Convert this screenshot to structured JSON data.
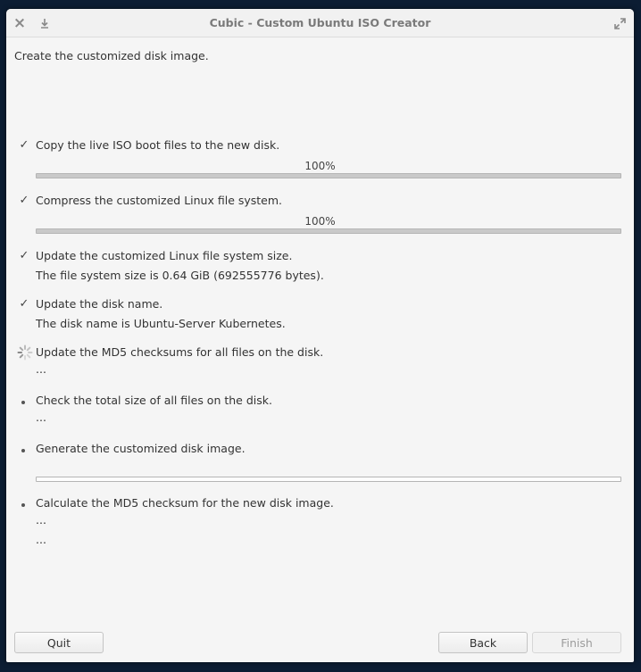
{
  "window": {
    "title": "Cubic - Custom Ubuntu ISO Creator"
  },
  "intro": "Create the customized disk image.",
  "steps": [
    {
      "status": "done",
      "label": "Copy the live ISO boot files to the new disk.",
      "progress_label": "100%",
      "progress": 1.0
    },
    {
      "status": "done",
      "label": "Compress the customized Linux file system.",
      "progress_label": "100%",
      "progress": 1.0
    },
    {
      "status": "done",
      "label": "Update the customized Linux file system size.",
      "detail": "The file system size is 0.64 GiB (692555776 bytes)."
    },
    {
      "status": "done",
      "label": "Update the disk name.",
      "detail": "The disk name is Ubuntu-Server Kubernetes."
    },
    {
      "status": "in-progress",
      "label": "Update the MD5 checksums for all files on the disk.",
      "detail": "..."
    },
    {
      "status": "pending",
      "label": "Check the total size of all files on the disk.",
      "detail": "..."
    },
    {
      "status": "pending",
      "label": "Generate the customized disk image.",
      "progress": 0.0
    },
    {
      "status": "pending",
      "label": "Calculate the MD5 checksum for the new disk image.",
      "detail": "...",
      "detail2": "..."
    }
  ],
  "icons": {
    "done": "check-icon",
    "pending": "bullet-icon",
    "in_progress": "spinner-icon"
  },
  "buttons": {
    "quit": "Quit",
    "back": "Back",
    "finish": "Finish"
  }
}
